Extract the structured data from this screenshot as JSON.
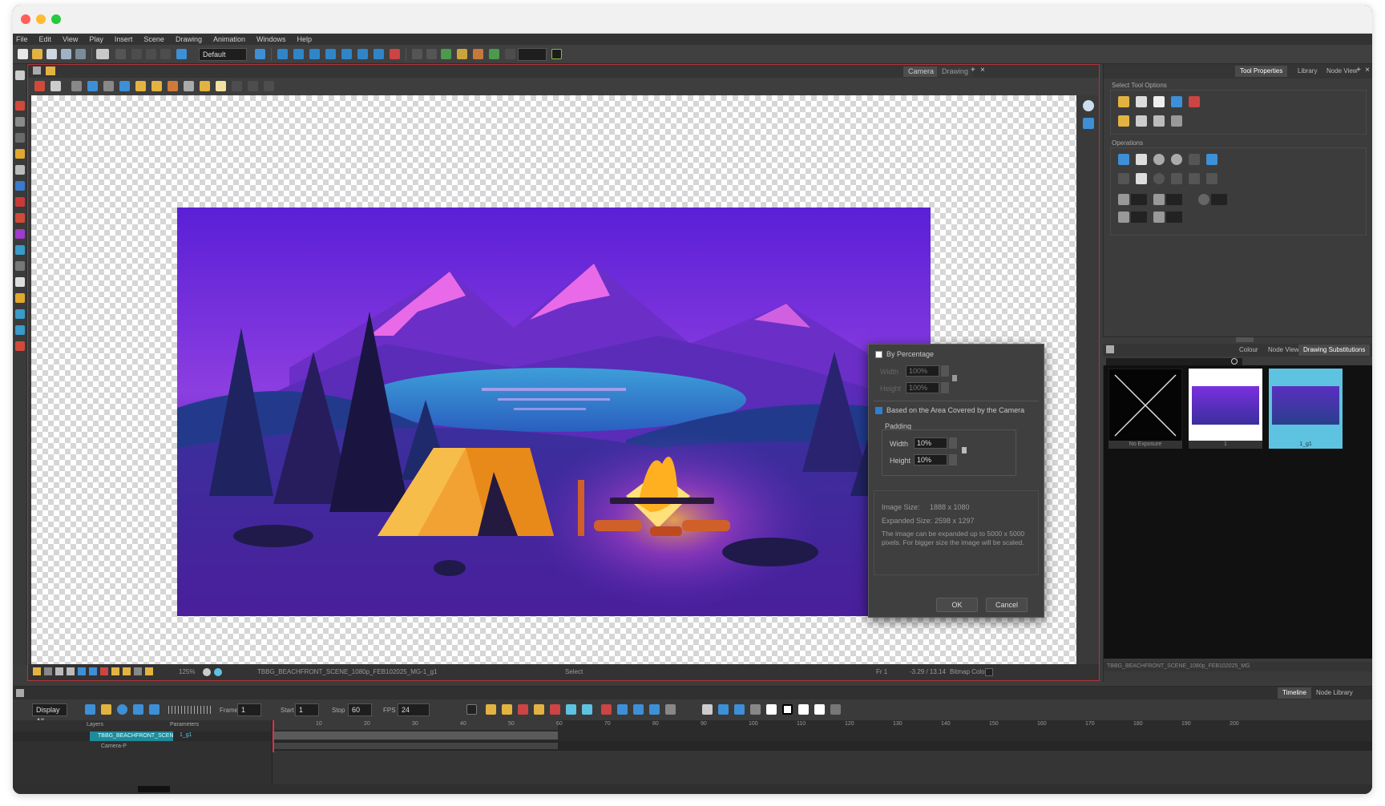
{
  "window": {
    "menu": [
      "File",
      "Edit",
      "View",
      "Play",
      "Insert",
      "Scene",
      "Drawing",
      "Animation",
      "Windows",
      "Help"
    ],
    "workspace_select": "Default"
  },
  "camera_view": {
    "tabs": [
      "Camera",
      "Drawing"
    ],
    "status": {
      "zoom": "125%",
      "drawing_name": "TBBG_BEACHFRONT_SCENE_1080p_FEB102025_MG-1_g1",
      "tool": "Select",
      "frame": "Fr 1",
      "coords": "-3.29 / 13.14",
      "colour_mode": "Bitmap Colour"
    }
  },
  "dialog": {
    "by_percentage_label": "By Percentage",
    "width_label": "Width",
    "height_label": "Height",
    "pct_width": "100%",
    "pct_height": "100%",
    "camera_label": "Based on the Area Covered by the Camera",
    "padding_label": "Padding",
    "pad_width": "10%",
    "pad_height": "10%",
    "image_size_label": "Image Size:",
    "image_size_value": "1888 x 1080",
    "expanded_size_label": "Expanded Size:",
    "expanded_size_value": "2598 x 1297",
    "note": "The image can be expanded up to 5000 x 5000 pixels. For bigger size the image will be scaled.",
    "ok": "OK",
    "cancel": "Cancel"
  },
  "tool_properties": {
    "tabs": [
      "Tool Properties",
      "Library",
      "Node View"
    ],
    "select_options_label": "Select Tool Options",
    "operations_label": "Operations"
  },
  "library": {
    "tabs": [
      "Colour",
      "Node View",
      "Drawing Substitutions"
    ],
    "thumbs": [
      {
        "label": "No Exposure"
      },
      {
        "label": "1"
      },
      {
        "label": "1_g1"
      }
    ],
    "footer": "TBBG_BEACHFRONT_SCENE_1080p_FEB102025_MG"
  },
  "timeline": {
    "tabs": [
      "Timeline",
      "Node Library"
    ],
    "display": "Display All",
    "frame_label": "Frame",
    "frame": "1",
    "start_label": "Start",
    "start": "1",
    "stop_label": "Stop",
    "stop": "60",
    "fps_label": "FPS",
    "fps": "24",
    "layers_label": "Layers",
    "params_label": "Parameters",
    "layers": [
      {
        "name": "TBBG_BEACHFRONT_SCENE",
        "drawing": "1_g1"
      },
      {
        "name": "Camera-P",
        "drawing": ""
      }
    ],
    "ruler": [
      "10",
      "20",
      "30",
      "40",
      "50",
      "60",
      "70",
      "80",
      "90",
      "100",
      "110",
      "120",
      "130",
      "140",
      "150",
      "160",
      "170",
      "180",
      "190",
      "200"
    ]
  },
  "colors": {
    "accent_red": "#b5343a",
    "selection_blue": "#2d7fd3",
    "thumb_selected": "#5ec3e0",
    "playhead": "#e0304a"
  }
}
